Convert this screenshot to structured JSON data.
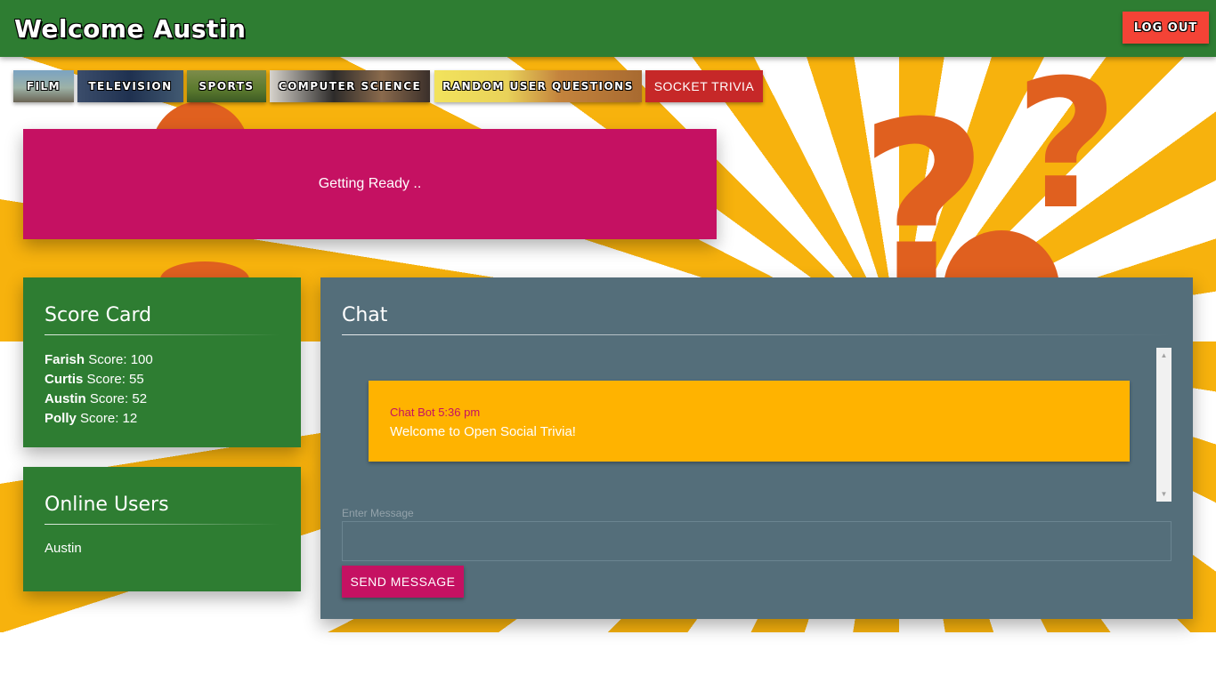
{
  "header": {
    "welcome": "Welcome Austin",
    "logout_label": "LOG OUT"
  },
  "categories": [
    {
      "label": "FILM"
    },
    {
      "label": "TELEVISION"
    },
    {
      "label": "SPORTS"
    },
    {
      "label": "COMPUTER SCIENCE"
    },
    {
      "label": "RANDOM USER QUESTIONS"
    },
    {
      "label": "SOCKET TRIVIA"
    }
  ],
  "status": {
    "text": "Getting Ready .."
  },
  "score_card": {
    "title": "Score Card",
    "entries": [
      {
        "name": "Farish",
        "label": "Score: 100"
      },
      {
        "name": "Curtis",
        "label": "Score: 55"
      },
      {
        "name": "Austin",
        "label": "Score: 52"
      },
      {
        "name": "Polly",
        "label": "Score: 12"
      }
    ]
  },
  "online_users": {
    "title": "Online Users",
    "users": [
      "Austin"
    ]
  },
  "chat": {
    "title": "Chat",
    "messages": [
      {
        "meta": "Chat Bot 5:36 pm",
        "text": "Welcome to Open Social Trivia!"
      }
    ],
    "input_label": "Enter Message",
    "input_value": "",
    "send_label": "SEND MESSAGE"
  },
  "colors": {
    "header": "#2e7d32",
    "logout": "#f44336",
    "status": "#c51162",
    "chat_panel": "#546e7a",
    "message": "#ffb300",
    "sunburst": "#f7b20d",
    "question_marks": "#e0601f"
  }
}
